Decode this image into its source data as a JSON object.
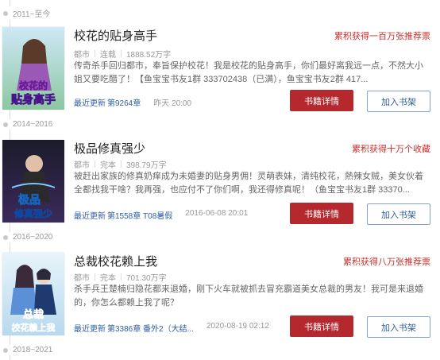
{
  "eras": [
    "2011~至今",
    "2014~2016",
    "2016~2020",
    "2018~2021"
  ],
  "books": [
    {
      "title": "校花的贴身高手",
      "honor": "累积获得一百万张推荐票",
      "category": "都市",
      "status": "连载",
      "words": "1888.52万字",
      "desc": "传奇杀手回归都市，奉旨保护校花！我是校花的贴身高手，你们最好离我远一点，不然大小姐又要吃醋了！【鱼宝宝书友1群 333702438（已满），鱼宝宝书友2群 417...",
      "latest_label": "最近更新",
      "latest_chapter": "第9264章",
      "time": "昨天 20:00",
      "cover_text": [
        "校花的",
        "贴身高手"
      ],
      "detail_label": "书籍详情",
      "shelf_label": "加入书架"
    },
    {
      "title": "极品修真强少",
      "honor": "累积获得十万个收藏",
      "category": "都市",
      "status": "完本",
      "words": "398.79万字",
      "desc": "被赶出家族的修真奶痒成为未婚妻的贴身男佣！灵萌表妹，清纯校花，熱辣女贼，美女伙着全都找我干啥？我再强，也应付不了你们啊，我还得修真呢！（鱼宝宝书友1群 33370...",
      "latest_label": "最近更新",
      "latest_chapter": "第1558章 T08暑假",
      "time": "2016-06-08 20:01",
      "cover_text": [
        "极品",
        "修真强少"
      ],
      "detail_label": "书籍详情",
      "shelf_label": "加入书架"
    },
    {
      "title": "总裁校花赖上我",
      "honor": "累积获得八万张推荐票",
      "category": "都市",
      "status": "完本",
      "words": "701.30万字",
      "desc": "杀手兵王楚楠归隐花都来退婚，刚下火车就被抓去冒充霸道美女总裁的男友！我可是来退婚的，你怎么都赖上我了呢？",
      "latest_label": "最近更新",
      "latest_chapter": "第3386章 番外2（大结...",
      "time": "2020-08-19 02:12",
      "cover_text": [
        "总裁",
        "校花赖上我"
      ],
      "detail_label": "书籍详情",
      "shelf_label": "加入书架"
    }
  ]
}
